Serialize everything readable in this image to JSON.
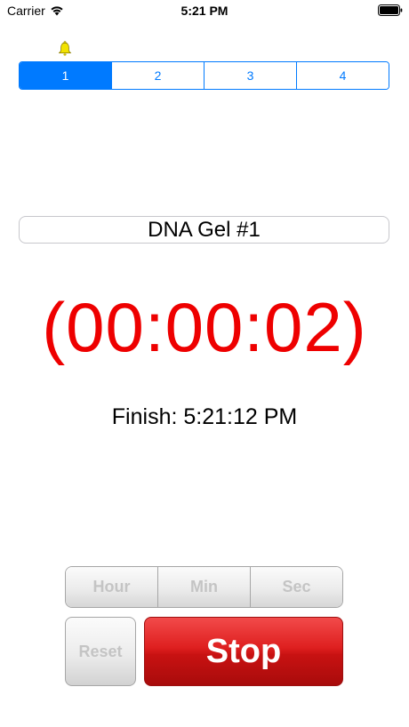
{
  "status_bar": {
    "carrier": "Carrier",
    "time": "5:21 PM",
    "icons": [
      "wifi-icon",
      "battery-icon"
    ]
  },
  "alarm": {
    "icon": "bell-icon",
    "color": "#f2e300"
  },
  "timer_tabs": {
    "items": [
      {
        "label": "1",
        "selected": true
      },
      {
        "label": "2",
        "selected": false
      },
      {
        "label": "3",
        "selected": false
      },
      {
        "label": "4",
        "selected": false
      }
    ],
    "accent_color": "#007aff"
  },
  "timer": {
    "name": "DNA Gel #1",
    "countdown": "(00:00:02)",
    "countdown_color": "#ee0000",
    "finish": "Finish: 5:21:12 PM"
  },
  "controls": {
    "hour_label": "Hour",
    "min_label": "Min",
    "sec_label": "Sec",
    "reset_label": "Reset",
    "stop_label": "Stop",
    "stop_color": "#d01818"
  }
}
